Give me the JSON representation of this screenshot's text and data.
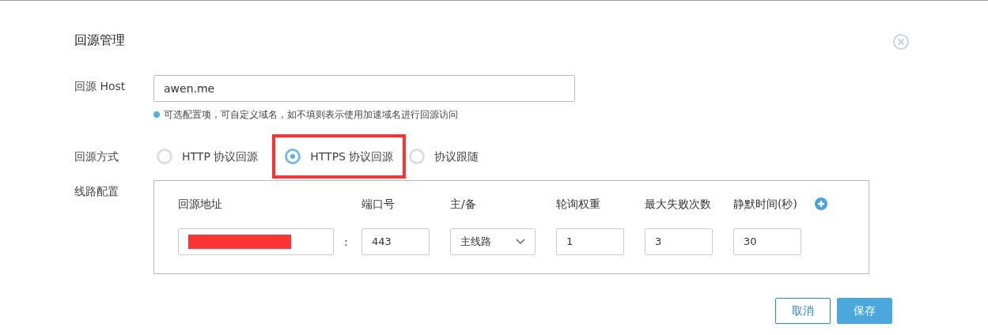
{
  "dialog": {
    "title": "回源管理"
  },
  "host": {
    "label": "回源 Host",
    "value": "awen.me",
    "hint": "可选配置项，可自定义域名，如不填则表示使用加速域名进行回源访问"
  },
  "mode": {
    "label": "回源方式",
    "options": [
      {
        "label": "HTTP 协议回源",
        "selected": false,
        "highlighted": false
      },
      {
        "label": "HTTPS 协议回源",
        "selected": true,
        "highlighted": true
      },
      {
        "label": "协议跟随",
        "selected": false,
        "highlighted": false
      }
    ]
  },
  "lines": {
    "label": "线路配置",
    "columns": [
      "回源地址",
      "端口号",
      "主/备",
      "轮询权重",
      "最大失败次数",
      "静默时间(秒)"
    ],
    "rows": [
      {
        "address_redacted": true,
        "separator": ":",
        "port": "443",
        "role": "主线路",
        "weight": "1",
        "max_failures": "3",
        "silent_time": "30"
      }
    ]
  },
  "buttons": [
    {
      "label": "取消",
      "kind": "secondary"
    },
    {
      "label": "保存",
      "kind": "primary"
    }
  ]
}
